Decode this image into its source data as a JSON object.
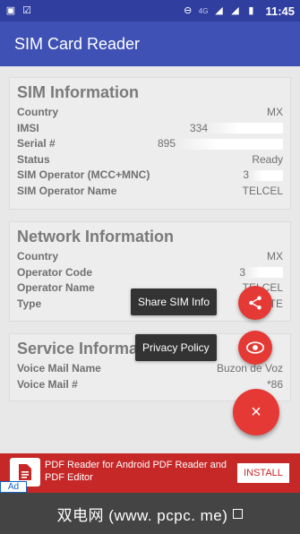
{
  "status_bar": {
    "time": "11:45",
    "network": "4G",
    "left_icons": [
      "image-icon",
      "checkbox-icon"
    ],
    "right_icons": [
      "do-not-disturb-icon",
      "signal-icon",
      "signal-icon",
      "battery-icon"
    ]
  },
  "app": {
    "title": "SIM Card Reader"
  },
  "sim": {
    "title": "SIM Information",
    "rows": [
      {
        "k": "Country",
        "v": "MX"
      },
      {
        "k": "IMSI",
        "v": "334"
      },
      {
        "k": "Serial #",
        "v": "895"
      },
      {
        "k": "Status",
        "v": "Ready"
      },
      {
        "k": "SIM Operator (MCC+MNC)",
        "v": "3"
      },
      {
        "k": "SIM Operator Name",
        "v": "TELCEL"
      }
    ]
  },
  "network": {
    "title": "Network Information",
    "rows": [
      {
        "k": "Country",
        "v": "MX"
      },
      {
        "k": "Operator Code",
        "v": "3"
      },
      {
        "k": "Operator Name",
        "v": "TELCEL"
      },
      {
        "k": "Type",
        "v": "LTE"
      }
    ]
  },
  "service": {
    "title": "Service Informa",
    "rows": [
      {
        "k": "Voice Mail Name",
        "v": "Buzon de Voz"
      },
      {
        "k": "Voice Mail #",
        "v": "*86"
      }
    ]
  },
  "fab_menu": {
    "share_label": "Share SIM Info",
    "privacy_label": "Privacy Policy",
    "close_symbol": "×"
  },
  "ad": {
    "text": "PDF Reader for Android PDF Reader and PDF Editor",
    "install": "INSTALL",
    "badge": "Ad"
  },
  "watermark": "双电网 (www. pcpc. me)",
  "colors": {
    "primary": "#3f51b5",
    "primary_dark": "#303f9f",
    "accent": "#e53935",
    "ad_bg": "#c62828"
  }
}
